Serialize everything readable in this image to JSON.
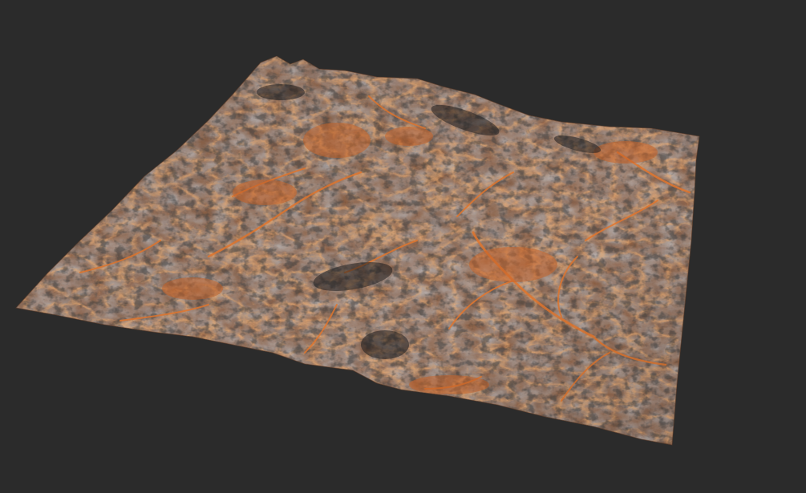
{
  "viewport": {
    "background_color": "#2b2b2b"
  },
  "terrain": {
    "object": "heightmap-terrain-mesh",
    "colors": {
      "base": "#8a5a3c",
      "sediment": "#c8652a",
      "flow": "#e2772f",
      "rock_light": "#7b8088",
      "rock_mid": "#55575b",
      "rock_dark": "#1e1e1f",
      "highlight": "#a9adb3"
    }
  }
}
